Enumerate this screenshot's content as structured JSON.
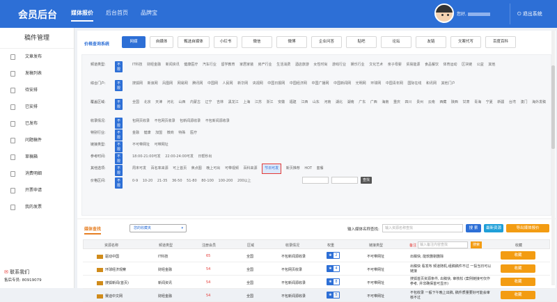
{
  "header": {
    "brand": "会员后台",
    "nav": [
      "媒体报价",
      "后台首页",
      "品牌宝"
    ],
    "greeting": "您好,",
    "logout": "退出系统"
  },
  "sidebar": {
    "title": "稿件管理",
    "items": [
      "文章发布",
      "发稿列表",
      "待安排",
      "已安排",
      "已发布",
      "问题稿件",
      "草稿箱",
      "消费明细",
      "开票申请",
      "我的发票"
    ],
    "contact": "联系我们",
    "phone": "售后专员: 80919079"
  },
  "tabs": {
    "label": "价格查询系统",
    "items": [
      "网媒",
      "自媒体",
      "甄选自媒体",
      "小红书",
      "微信",
      "微博",
      "企业问答",
      "贴吧",
      "论坛",
      "友链",
      "文案代写",
      "百度百科"
    ]
  },
  "filters": [
    {
      "label": "频道类型:",
      "tag": "不限",
      "opts": "IT科技 财经金融 新闻资讯 健康医疗 汽车行业 留学教育 家居家装 房产行业 生活消费 酒店旅游 女性时尚 游戏行业 娱乐行业 文化艺术 亲子母婴 贸易能源 食品餐饮 体育运动 区块链 公益 其他"
    },
    {
      "label": "综合门户:",
      "tag": "不限",
      "opts": "搜狐网 新浪网 凤凰网 网易网 腾讯网 中国网 人民网 新华网 央视网 中国日报网 中国经济网 中国广播网 中国新闻网 光明网 环球网 中国青年网 国际在线 和讯网 其他门户"
    },
    {
      "label": "覆盖区域:",
      "tag": "不限",
      "opts": "全国 北京 天津 河北 山西 内蒙古 辽宁 吉林 黑龙江 上海 江苏 浙江 安徽 福建 江西 山东 河南 湖北 湖南 广东 广西 海南 重庆 四川 贵州 云南 西藏 陕西 甘肃 青海 宁夏 新疆 台湾 澳门 海外发稿"
    },
    {
      "label": "收录情况:",
      "tag": "不限",
      "opts": "包网页收录 不包网页收录 包新闻源收录 不包新闻源收录"
    },
    {
      "label": "特别行业:",
      "tag": "不限",
      "opts": "金融 健康 加盟 微商 特殊 医疗"
    },
    {
      "label": "链接类型:",
      "tag": "不限",
      "opts": "不可带网址 可带网址"
    },
    {
      "label": "参考时间:",
      "tag": "不限",
      "opts": "18:00-21:00可发 22:00-24:00可发 日帮秒出"
    },
    {
      "label": "其他选项:",
      "tag": "不限",
      "opts": "周末可发 百名率来源 可上首页 焦点图 晚上可出 可带视频 百科来源",
      "highlight": "节日可发",
      "opts_after": "新页推荐 HOT 套餐"
    },
    {
      "label": "价格区间:",
      "tag": "不限",
      "opts": "0-9 10-20 21-35 36-50 51-80 80-100 100-200 200以上",
      "go": "查找"
    }
  ],
  "list": {
    "tab": "媒体查找",
    "select": "您的收藏夹",
    "search_label": "输入媒体名称查找:",
    "search_placeholder": "输入资源名称查找",
    "btn_search": "搜 索",
    "btn_recent": "最新资源",
    "btn_export": "导出媒体报价"
  },
  "table": {
    "headers": [
      "资源名称",
      "频道类型",
      "注册会员",
      "区域",
      "收录情况",
      "权重",
      "链接类型",
      "备注",
      "收藏"
    ],
    "note_placeholder": "输入备注内容查找",
    "note_btn": "搜索",
    "rows": [
      {
        "name": "驱动中国",
        "type": "IT科技",
        "price": "65",
        "area": "全国",
        "index": "不包新闻源收录",
        "weight": "2",
        "link": "不可带网址",
        "note": "出稿快, 能软删剔删除",
        "fav": "收藏"
      },
      {
        "name": "环球经济观察",
        "type": "财经金融",
        "price": "54",
        "area": "全国",
        "index": "不包网页收录",
        "weight": "4",
        "link": "不可带网址",
        "note": "出稿快 看发布 频道随机,组稿稿件不过 一投当日可以链接",
        "fav": "收藏"
      },
      {
        "name": "搜狐新闻(首页)",
        "type": "新闻资讯",
        "price": "54",
        "area": "全国",
        "index": "不包新闻源收录",
        "weight": "8",
        "link": "不可带网址",
        "note": "搜狐首页资源条件, 出稿快, 审核松 (案例链接可仅作参考, 并非确保首可显示)",
        "fav": "收藏"
      },
      {
        "name": "赛迪中文网",
        "type": "财经金融",
        "price": "54",
        "area": "全国",
        "index": "不包新闻源收录",
        "weight": "5",
        "link": "不可带网址",
        "note": "不包收录 一般下午晚上出稿, 稿件质量要好可能会审核不过",
        "fav": "收藏"
      }
    ]
  }
}
